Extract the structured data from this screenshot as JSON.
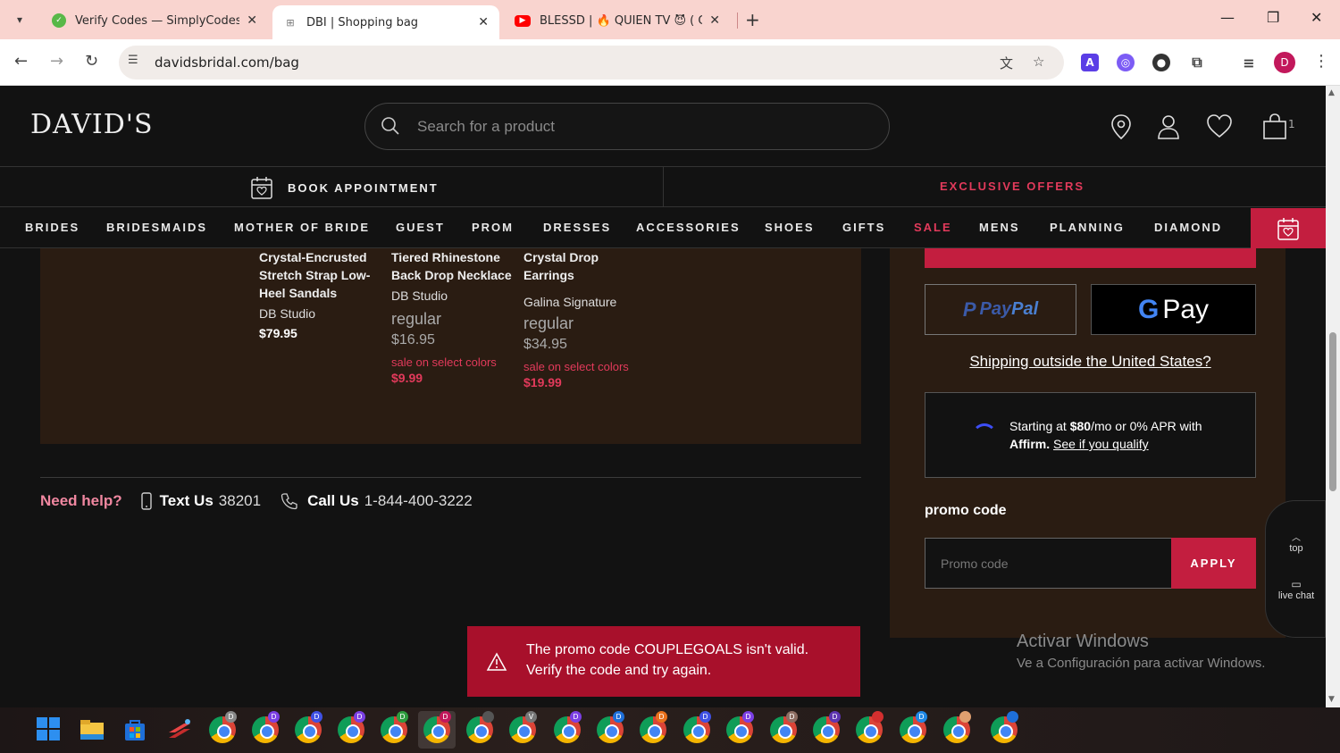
{
  "browser": {
    "tabs": [
      {
        "title": "Verify Codes — SimplyCodes",
        "close": "✕"
      },
      {
        "title": "DBI | Shopping bag",
        "close": "✕"
      },
      {
        "title": "BLESSD | 🔥 QUIEN TV 😈 ( OFF",
        "close": "✕"
      }
    ],
    "new_tab": "+",
    "url": "davidsbridal.com/bag",
    "profile_initial": "D"
  },
  "header": {
    "logo": "DAVID'S",
    "search_placeholder": "Search for a product",
    "bag_count": "1"
  },
  "subbar": {
    "book_appointment": "BOOK APPOINTMENT",
    "exclusive_offers": "EXCLUSIVE OFFERS"
  },
  "nav": {
    "items": [
      "BRIDES",
      "BRIDESMAIDS",
      "MOTHER OF BRIDE",
      "GUEST",
      "PROM",
      "DRESSES",
      "ACCESSORIES",
      "SHOES",
      "GIFTS",
      "SALE",
      "MENS",
      "PLANNING",
      "DIAMOND"
    ]
  },
  "products": [
    {
      "name": "Crystal-Encrusted Stretch Strap Low-Heel Sandals",
      "brand": "DB Studio",
      "price": "$79.95"
    },
    {
      "name": "Tiered Rhinestone Back Drop Necklace",
      "brand": "DB Studio",
      "regular_label": "regular",
      "regular_price": "$16.95",
      "sale_label": "sale on select colors",
      "sale_price": "$9.99"
    },
    {
      "name": "Crystal Drop Earrings",
      "brand": "Galina Signature",
      "regular_label": "regular",
      "regular_price": "$34.95",
      "sale_label": "sale on select colors",
      "sale_price": "$19.99"
    }
  ],
  "help": {
    "need_help": "Need help?",
    "text_label": "Text Us",
    "text_number": "38201",
    "call_label": "Call Us",
    "call_number": "1-844-400-3222"
  },
  "summary": {
    "paypal_1": "Pay",
    "paypal_2": "Pal",
    "gpay_g": "G",
    "gpay_pay": "Pay",
    "shipping_link": "Shipping outside the United States?",
    "affirm_prefix": "Starting at ",
    "affirm_amount": "$80",
    "affirm_mid": "/mo or 0% APR with",
    "affirm_brand": "Affirm.",
    "affirm_link": "See if you qualify",
    "promo_title": "promo code",
    "promo_placeholder": "Promo code",
    "apply_label": "APPLY"
  },
  "floatbar": {
    "top": "top",
    "live_chat": "live chat"
  },
  "toast": {
    "message_line1": "The promo code COUPLEGOALS isn't valid.",
    "message_line2": "Verify the code and try again."
  },
  "watermark": {
    "line1": "Activar Windows",
    "line2": "Ve a Configuración para activar Windows."
  },
  "taskbar": {
    "badges": [
      "D",
      "D",
      "D",
      "D",
      "D",
      "D",
      "",
      "V",
      "D",
      "D",
      "D",
      "D",
      "D",
      "D",
      "D",
      "",
      "D",
      "",
      ""
    ]
  },
  "colors": {
    "accent": "#c31e3f",
    "sale": "#e23a5b",
    "panel": "#2a1c12",
    "help": "#f087a0"
  }
}
